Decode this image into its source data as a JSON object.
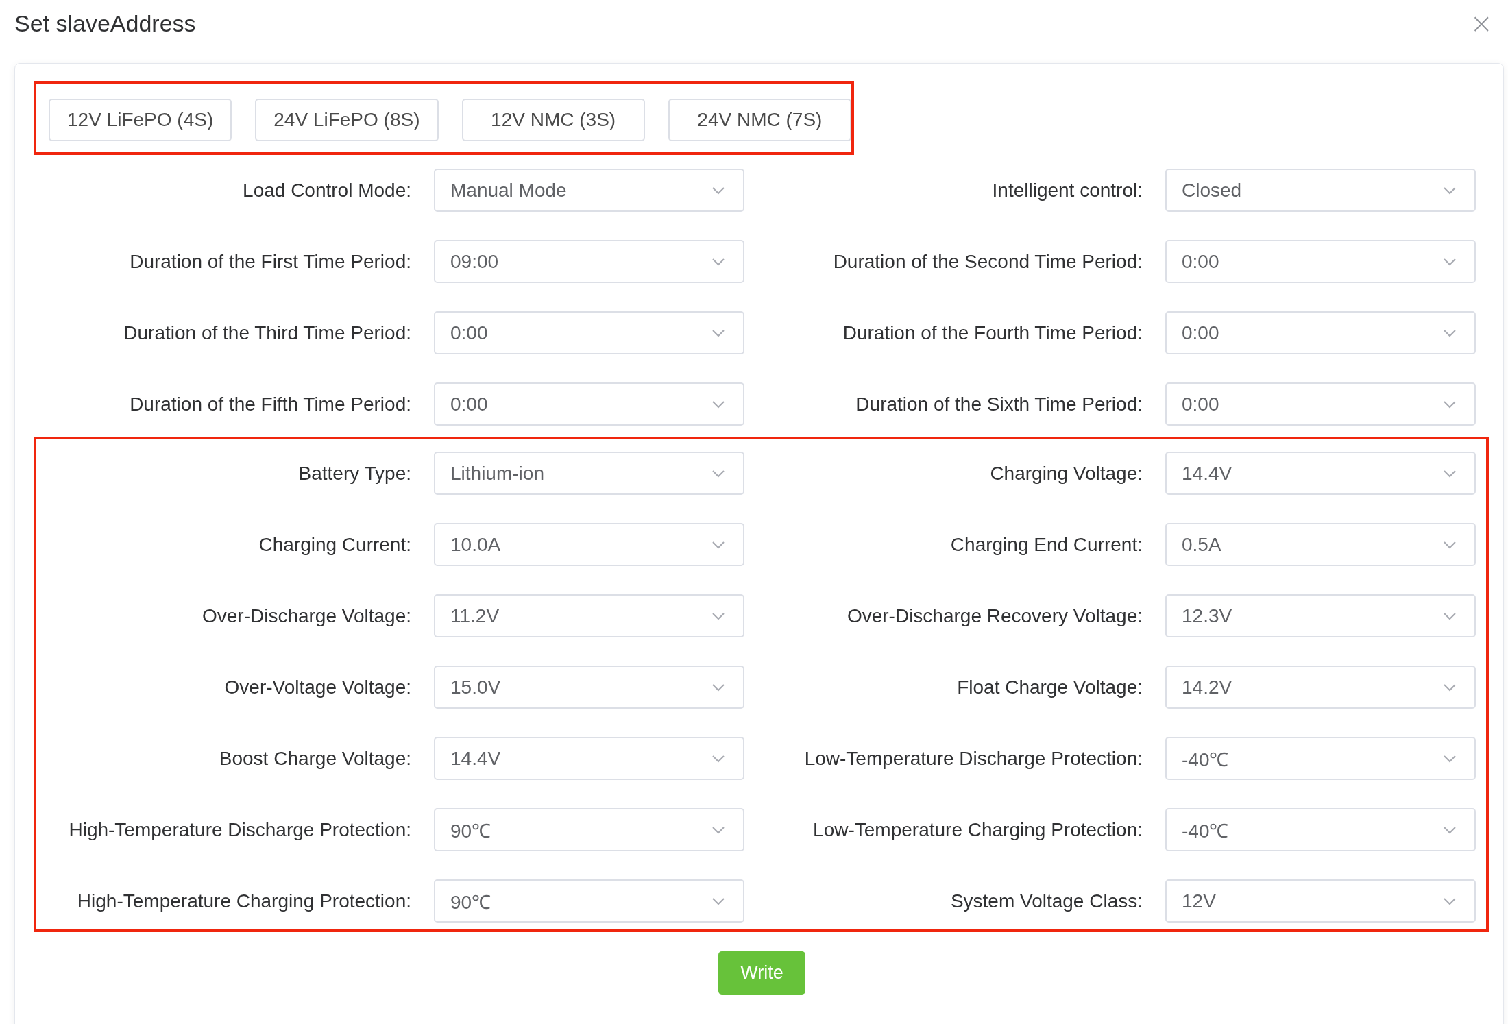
{
  "dialog": {
    "title": "Set slaveAddress",
    "close": "×"
  },
  "presets": {
    "highlighted": true,
    "buttons": [
      "12V LiFePO (4S)",
      "24V LiFePO (8S)",
      "12V NMC (3S)",
      "24V NMC (7S)"
    ]
  },
  "sections": [
    {
      "highlighted": false,
      "fields": [
        {
          "label": "Load Control Mode:",
          "value": "Manual Mode"
        },
        {
          "label": "Intelligent control:",
          "value": "Closed"
        },
        {
          "label": "Duration of the First Time Period:",
          "value": "09:00"
        },
        {
          "label": "Duration of the Second Time Period:",
          "value": "0:00"
        },
        {
          "label": "Duration of the Third Time Period:",
          "value": "0:00"
        },
        {
          "label": "Duration of the Fourth Time Period:",
          "value": "0:00"
        },
        {
          "label": "Duration of the Fifth Time Period:",
          "value": "0:00"
        },
        {
          "label": "Duration of the Sixth Time Period:",
          "value": "0:00"
        }
      ]
    },
    {
      "highlighted": true,
      "fields": [
        {
          "label": "Battery Type:",
          "value": "Lithium-ion"
        },
        {
          "label": "Charging Voltage:",
          "value": "14.4V"
        },
        {
          "label": "Charging Current:",
          "value": "10.0A"
        },
        {
          "label": "Charging End Current:",
          "value": "0.5A"
        },
        {
          "label": "Over-Discharge Voltage:",
          "value": "11.2V"
        },
        {
          "label": "Over-Discharge Recovery Voltage:",
          "value": "12.3V"
        },
        {
          "label": "Over-Voltage Voltage:",
          "value": "15.0V"
        },
        {
          "label": "Float Charge Voltage:",
          "value": "14.2V"
        },
        {
          "label": "Boost Charge Voltage:",
          "value": "14.4V"
        },
        {
          "label": "Low-Temperature Discharge Protection:",
          "value": "-40℃"
        },
        {
          "label": "High-Temperature Discharge Protection:",
          "value": "90℃"
        },
        {
          "label": "Low-Temperature Charging Protection:",
          "value": "-40℃"
        },
        {
          "label": "High-Temperature Charging Protection:",
          "value": "90℃"
        },
        {
          "label": "System Voltage Class:",
          "value": "12V"
        }
      ]
    }
  ],
  "write_button": "Write"
}
